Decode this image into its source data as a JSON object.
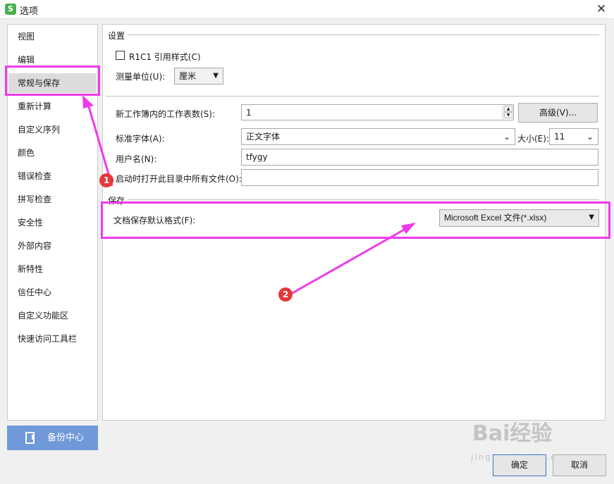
{
  "window": {
    "title": "选项",
    "app_icon": "S"
  },
  "nav": {
    "items": [
      {
        "label": "视图"
      },
      {
        "label": "编辑"
      },
      {
        "label": "常规与保存"
      },
      {
        "label": "重新计算"
      },
      {
        "label": "自定义序列"
      },
      {
        "label": "颜色"
      },
      {
        "label": "错误检查"
      },
      {
        "label": "拼写检查"
      },
      {
        "label": "安全性"
      },
      {
        "label": "外部内容"
      },
      {
        "label": "新特性"
      },
      {
        "label": "信任中心"
      },
      {
        "label": "自定义功能区"
      },
      {
        "label": "快速访问工具栏"
      }
    ],
    "selected": "常规与保存"
  },
  "backup": {
    "label": "备份中心",
    "icon": "backup-icon"
  },
  "settings": {
    "section_title": "设置",
    "r1c1_label": "R1C1 引用样式(C)",
    "r1c1_checked": false,
    "unit_label": "测量单位(U):",
    "unit_value": "厘米",
    "sheets_label": "新工作簿内的工作表数(S):",
    "sheets_value": "1",
    "advanced_label": "高级(V)...",
    "font_label": "标准字体(A):",
    "font_value": "正文字体",
    "size_label": "大小(E):",
    "size_value": "11",
    "user_label": "用户名(N):",
    "user_value": "tfygy",
    "startup_label": "启动时打开此目录中所有文件(O):",
    "startup_value": ""
  },
  "save": {
    "section_title": "保存",
    "format_label": "文档保存默认格式(F):",
    "format_value": "Microsoft Excel 文件(*.xlsx)"
  },
  "annotations": {
    "badge1": "1",
    "badge2": "2",
    "color": "#ee3bea"
  },
  "footer": {
    "ok_label": "确定",
    "cancel_label": "取消"
  },
  "watermark": {
    "text": "Bai经验",
    "sub": "jingyan.baidu.com"
  }
}
